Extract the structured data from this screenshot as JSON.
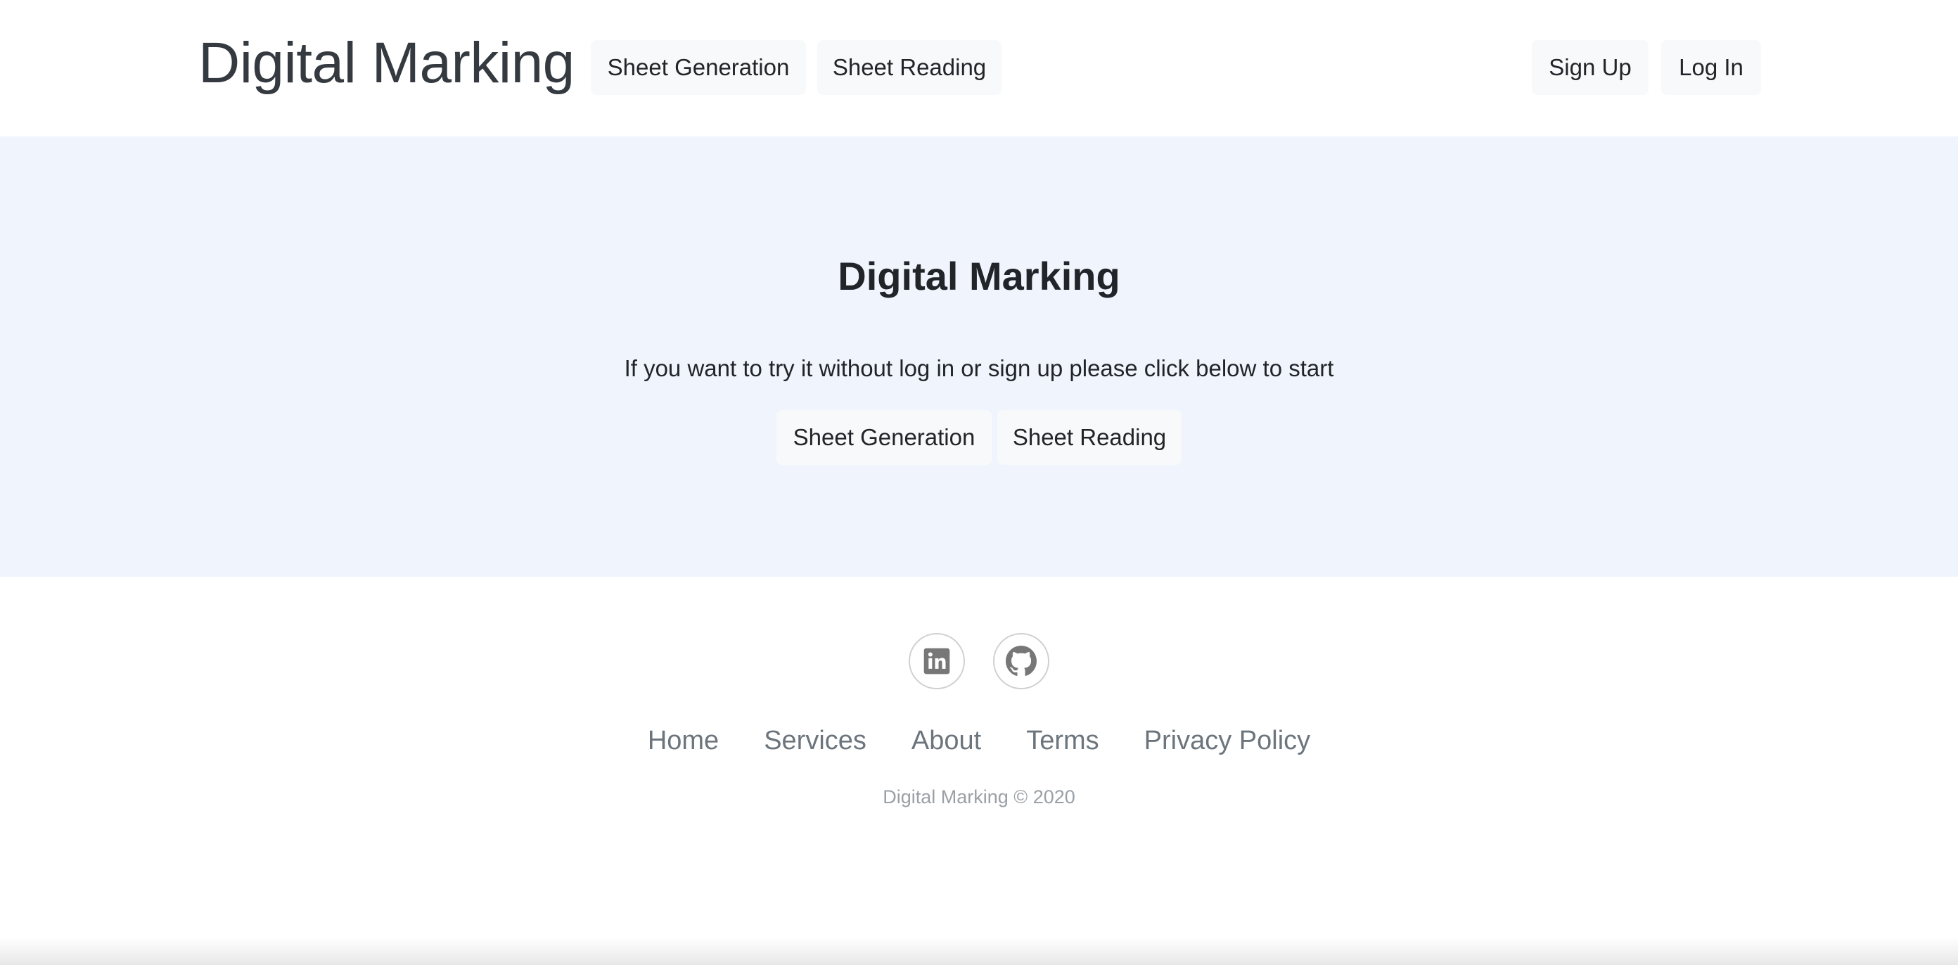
{
  "header": {
    "brand": "Digital Marking",
    "nav": {
      "sheet_generation": "Sheet Generation",
      "sheet_reading": "Sheet Reading"
    },
    "auth": {
      "sign_up": "Sign Up",
      "log_in": "Log In"
    }
  },
  "hero": {
    "title": "Digital Marking",
    "text": "If you want to try it without log in or sign up please click below to start",
    "buttons": {
      "sheet_generation": "Sheet Generation",
      "sheet_reading": "Sheet Reading"
    }
  },
  "footer": {
    "social": [
      {
        "icon": "linkedin-icon"
      },
      {
        "icon": "github-icon"
      }
    ],
    "links": [
      "Home",
      "Services",
      "About",
      "Terms",
      "Privacy Policy"
    ],
    "copyright": "Digital Marking © 2020"
  },
  "colors": {
    "hero_background": "#f0f5fd",
    "button_background": "#f8f9fa",
    "link_gray": "#6c757d",
    "icon_gray": "#777777"
  }
}
